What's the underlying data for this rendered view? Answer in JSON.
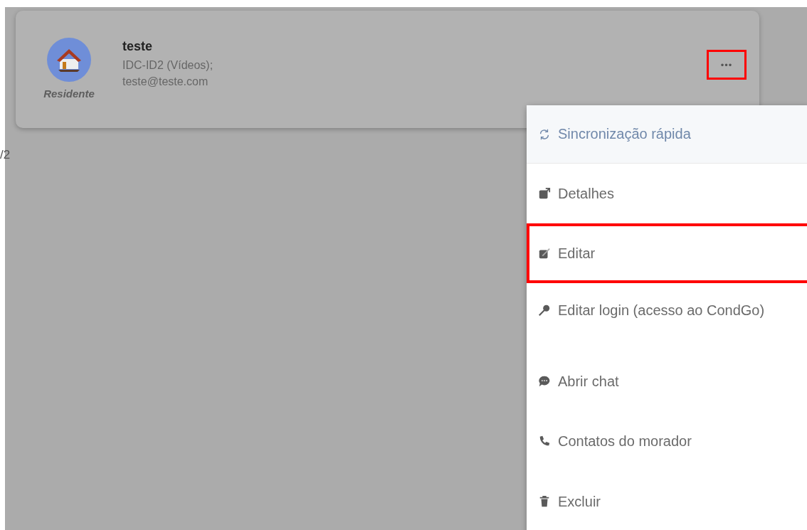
{
  "resident_card": {
    "role": "Residente",
    "name": "teste",
    "unit": "IDC-ID2 (Vídeos);",
    "email": "teste@teste.com",
    "more_button": {
      "label": "•••",
      "highlighted": true
    }
  },
  "pagination": "/2",
  "menu": {
    "items": [
      {
        "kind": "sync",
        "label": "Sincronização rápida",
        "selected": true,
        "highlighted": false
      },
      {
        "kind": "details",
        "label": "Detalhes",
        "selected": false,
        "highlighted": false
      },
      {
        "kind": "edit",
        "label": "Editar",
        "selected": false,
        "highlighted": true
      },
      {
        "kind": "login",
        "label": "Editar login (acesso ao CondGo)",
        "selected": false,
        "highlighted": false
      },
      {
        "kind": "chat",
        "label": "Abrir chat",
        "selected": false,
        "highlighted": false
      },
      {
        "kind": "phone",
        "label": "Contatos do morador",
        "selected": false,
        "highlighted": false
      },
      {
        "kind": "delete",
        "label": "Excluir",
        "selected": false,
        "highlighted": false
      }
    ]
  }
}
